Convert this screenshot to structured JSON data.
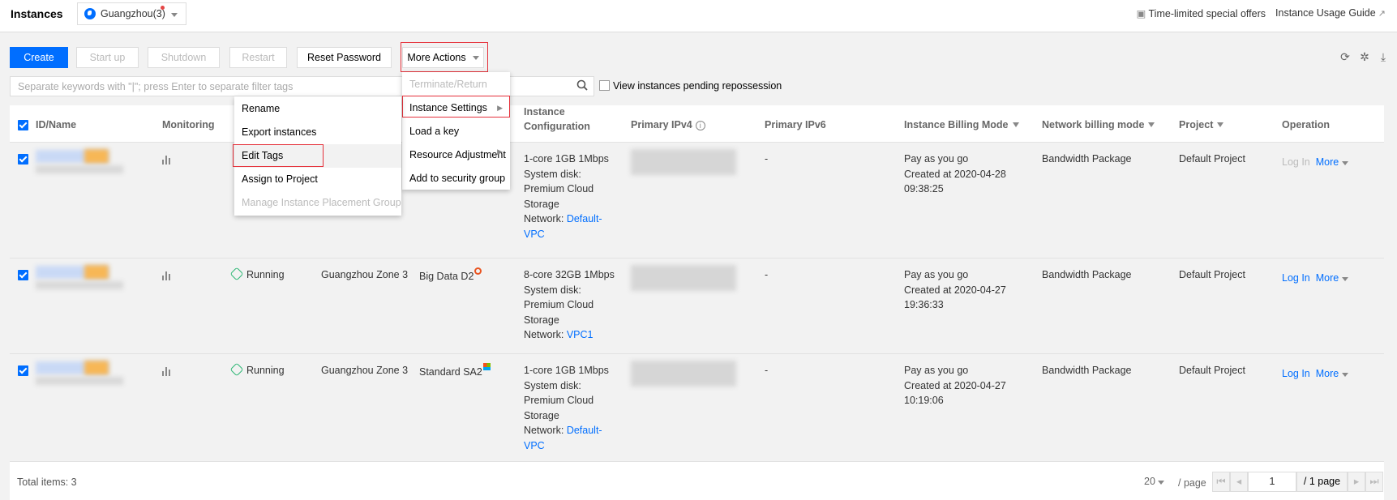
{
  "header": {
    "title": "Instances",
    "region": "Guangzhou(3)",
    "links": [
      {
        "label": "Time-limited special offers",
        "icon": "qr-code-icon"
      },
      {
        "label": "Instance Usage Guide",
        "icon": "external-link-icon"
      }
    ]
  },
  "toolbar": {
    "create": "Create",
    "start_up": "Start up",
    "shutdown": "Shutdown",
    "restart": "Restart",
    "reset_password": "Reset Password",
    "more_actions": "More Actions",
    "icons": [
      "refresh-icon",
      "settings-icon",
      "download-icon"
    ]
  },
  "search": {
    "placeholder": "Separate keywords with \"|\"; press Enter to separate filter tags",
    "pending_label": "View instances pending repossession",
    "pending_checked": false
  },
  "table": {
    "columns": {
      "id_name": "ID/Name",
      "monitoring": "Monitoring",
      "config_1": "Instance",
      "config_2": "Configuration",
      "ipv4": "Primary IPv4",
      "ipv6": "Primary IPv6",
      "billing": "Instance Billing Mode",
      "net_billing": "Network billing mode",
      "project": "Project",
      "operation": "Operation"
    },
    "rows": [
      {
        "checked": true,
        "status": "",
        "zone": "",
        "type": "",
        "config": [
          "1-core 1GB 1Mbps",
          "System disk:",
          "Premium Cloud",
          "Storage"
        ],
        "network_label": "Network:",
        "network": "Default-VPC",
        "ipv6": "-",
        "billing": "Pay as you go",
        "created": "Created at 2020-04-28",
        "created_time": "09:38:25",
        "net_billing": "Bandwidth Package",
        "project": "Default Project",
        "login": "Log In",
        "more": "More",
        "login_enabled": false
      },
      {
        "checked": true,
        "status": "Running",
        "zone": "Guangzhou Zone 3",
        "type": "Big Data D2",
        "os_icon": "ubuntu-icon",
        "config": [
          "8-core 32GB 1Mbps",
          "System disk:",
          "Premium Cloud",
          "Storage"
        ],
        "network_label": "Network:",
        "network": "VPC1",
        "ipv6": "-",
        "billing": "Pay as you go",
        "created": "Created at 2020-04-27",
        "created_time": "19:36:33",
        "net_billing": "Bandwidth Package",
        "project": "Default Project",
        "login": "Log In",
        "more": "More",
        "login_enabled": true
      },
      {
        "checked": true,
        "status": "Running",
        "zone": "Guangzhou Zone 3",
        "type": "Standard SA2",
        "os_icon": "windows-icon",
        "config": [
          "1-core 1GB 1Mbps",
          "System disk:",
          "Premium Cloud",
          "Storage"
        ],
        "network_label": "Network:",
        "network": "Default-VPC",
        "ipv6": "-",
        "billing": "Pay as you go",
        "created": "Created at 2020-04-27",
        "created_time": "10:19:06",
        "net_billing": "Bandwidth Package",
        "project": "Default Project",
        "login": "Log In",
        "more": "More",
        "login_enabled": true
      }
    ]
  },
  "footer": {
    "total": "Total items: 3",
    "page_size": "20",
    "per_page": "/ page",
    "page": "1",
    "page_total": "/ 1 page"
  },
  "more_menu": [
    {
      "label": "Terminate/Return",
      "disabled": true
    },
    {
      "label": "Instance Settings",
      "submenu": true,
      "highlighted": true
    },
    {
      "label": "Load a key"
    },
    {
      "label": "Resource Adjustment",
      "submenu": true
    },
    {
      "label": "Add to security group"
    }
  ],
  "settings_submenu": [
    {
      "label": "Rename"
    },
    {
      "label": "Export instances"
    },
    {
      "label": "Edit Tags",
      "highlighted": true
    },
    {
      "label": "Assign to Project"
    },
    {
      "label": "Manage Instance Placement Group",
      "disabled": true
    }
  ],
  "colors": {
    "primary": "#006eff",
    "highlight_box": "#e5303a",
    "running": "#2bb673"
  }
}
